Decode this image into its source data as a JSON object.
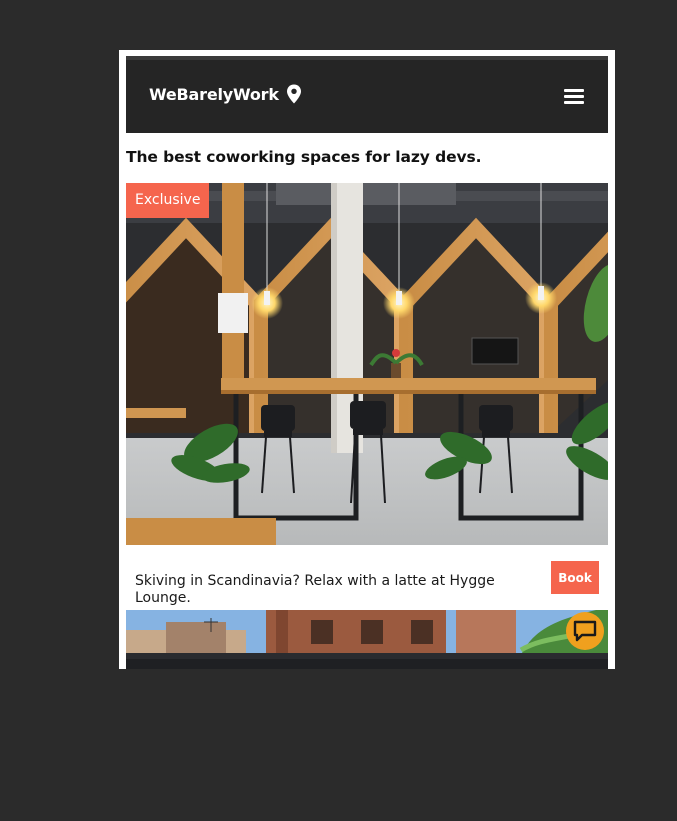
{
  "header": {
    "brand": "WeBarelyWork",
    "brand_icon": "location-pin-icon",
    "menu_icon": "hamburger-menu-icon"
  },
  "tagline": "The best coworking spaces for lazy devs.",
  "featured": {
    "badge": "Exclusive",
    "caption": "Skiving in Scandinavia? Relax with a latte at Hygge Lounge.",
    "book_label": "Book"
  },
  "chat": {
    "icon": "chat-bubble-icon"
  },
  "colors": {
    "accent": "#f5654d",
    "chat": "#f0a01e",
    "navbar": "#252525",
    "page_background": "#2b2b2b"
  }
}
